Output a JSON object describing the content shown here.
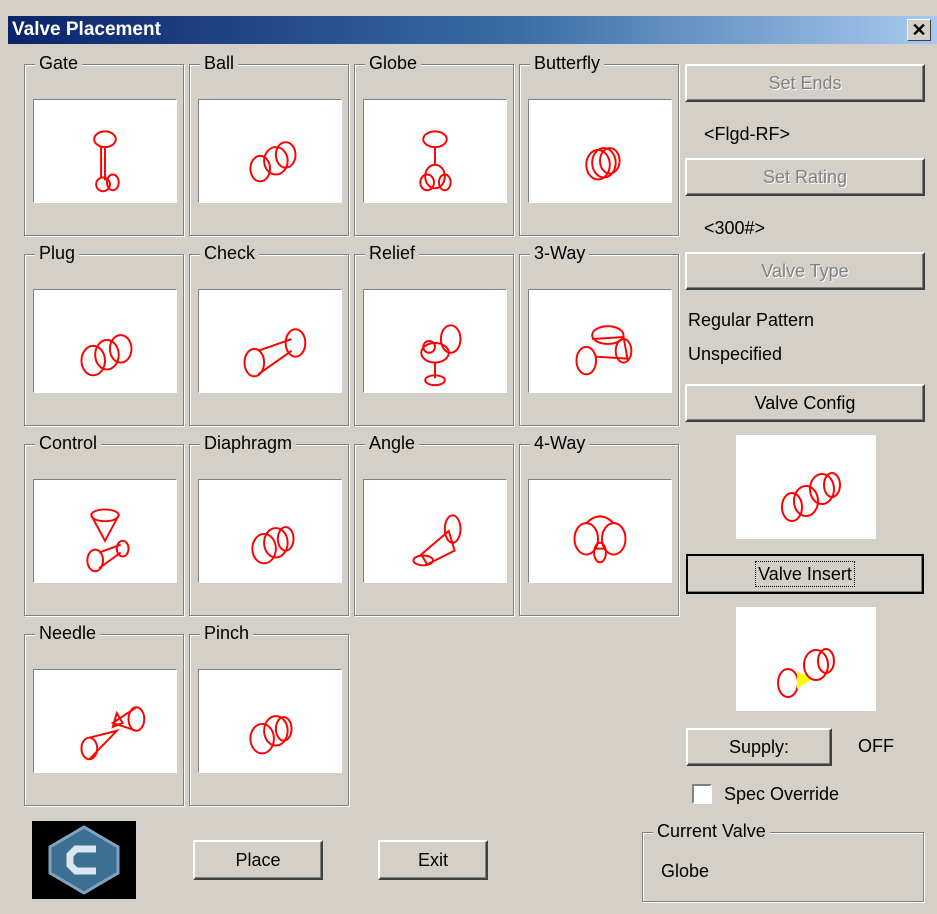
{
  "window": {
    "title": "Valve Placement",
    "close_glyph": "✕"
  },
  "valves": [
    "Gate",
    "Ball",
    "Globe",
    "Butterfly",
    "Plug",
    "Check",
    "Relief",
    "3-Way",
    "Control",
    "Diaphragm",
    "Angle",
    "4-Way",
    "Needle",
    "Pinch"
  ],
  "side": {
    "set_ends_label": "Set Ends",
    "ends_value": "<Flgd-RF>",
    "set_rating_label": "Set Rating",
    "rating_value": "<300#>",
    "valve_type_label": "Valve Type",
    "type_value_1": "Regular Pattern",
    "type_value_2": "Unspecified",
    "valve_config_label": "Valve Config",
    "valve_insert_label": "Valve Insert",
    "supply_label": "Supply:",
    "supply_value": "OFF",
    "spec_override_label": "Spec Override",
    "spec_override_checked": false
  },
  "footer": {
    "place_label": "Place",
    "exit_label": "Exit",
    "current_valve_legend": "Current Valve",
    "current_valve_value": "Globe"
  },
  "colors": {
    "drawing_stroke": "#ff0000",
    "highlight": "#ffff00",
    "title_gradient_start": "#0a246a"
  }
}
